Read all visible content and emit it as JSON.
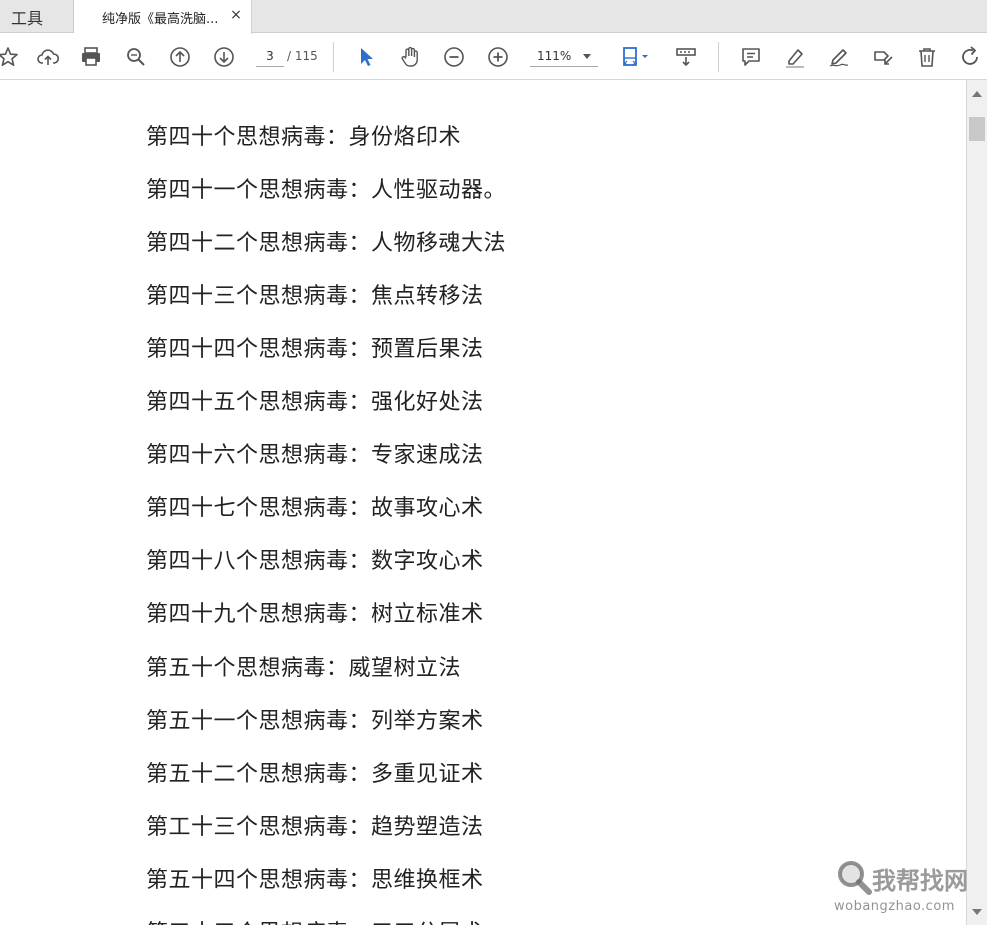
{
  "tabs": {
    "tools_label": "工具",
    "document_label": "纯净版《最高洗脑...",
    "close_glyph": "×"
  },
  "toolbar": {
    "icons": [
      "bookmark-star-icon",
      "upload-cloud-icon",
      "print-icon",
      "zoom-search-icon",
      "prev-page-icon",
      "next-page-icon",
      "select-cursor-icon",
      "hand-tool-icon",
      "zoom-out-icon",
      "zoom-in-icon",
      "fit-page-icon",
      "scroll-mode-icon",
      "comment-icon",
      "highlight-icon",
      "sign-icon",
      "share-icon",
      "delete-icon",
      "rotate-icon"
    ],
    "current_page": "3",
    "page_total": "/ 115",
    "zoom_level": "111%",
    "accent_color": "#2d6fcf"
  },
  "document": {
    "lines": [
      "第四十个思想病毒：身份烙印术",
      "第四十一个思想病毒：人性驱动器。",
      "第四十二个思想病毒：人物移魂大法",
      "第四十三个思想病毒：焦点转移法",
      "第四十四个思想病毒：预置后果法",
      "第四十五个思想病毒：强化好处法",
      "第四十六个思想病毒：专家速成法",
      "第四十七个思想病毒：故事攻心术",
      "第四十八个思想病毒：数字攻心术",
      "第四十九个思想病毒：树立标准术",
      "第五十个思想病毒：威望树立法",
      "第五十一个思想病毒：列举方案术",
      "第五十二个思想病毒：多重见证术",
      "第工十三个思想病毒：趋势塑造法",
      "第五十四个思想病毒：思维换框术",
      "第五十五个思想病毒：三三分层术"
    ]
  },
  "watermark": {
    "title": "我帮找网",
    "url": "wobangzhao.com"
  }
}
